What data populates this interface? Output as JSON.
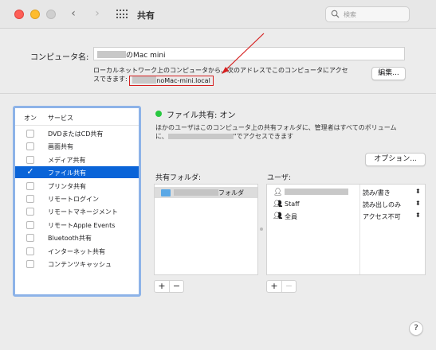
{
  "window": {
    "title": "共有",
    "search_placeholder": "検索",
    "back_icon": "chevron-left-icon",
    "forward_icon": "chevron-right-icon",
    "grid_icon": "grid-icon"
  },
  "computer_name": {
    "label": "コンピュータ名:",
    "value_suffix": "のMac mini",
    "local_text_line1": "ローカルネットワーク上のコンピュータから、次のアドレスでこのコンピュータにアクセ",
    "local_text_line2": "スできます:",
    "local_address_suffix": "noMac-mini.local",
    "edit_label": "編集..."
  },
  "services": {
    "col_on": "オン",
    "col_service": "サービス",
    "items": [
      {
        "label": "DVDまたはCD共有",
        "checked": false,
        "selected": false
      },
      {
        "label": "画面共有",
        "checked": false,
        "selected": false
      },
      {
        "label": "メディア共有",
        "checked": false,
        "selected": false
      },
      {
        "label": "ファイル共有",
        "checked": true,
        "selected": true
      },
      {
        "label": "プリンタ共有",
        "checked": false,
        "selected": false
      },
      {
        "label": "リモートログイン",
        "checked": false,
        "selected": false
      },
      {
        "label": "リモートマネージメント",
        "checked": false,
        "selected": false
      },
      {
        "label": "リモートApple Events",
        "checked": false,
        "selected": false
      },
      {
        "label": "Bluetooth共有",
        "checked": false,
        "selected": false
      },
      {
        "label": "インターネット共有",
        "checked": false,
        "selected": false
      },
      {
        "label": "コンテンツキャッシュ",
        "checked": false,
        "selected": false
      }
    ]
  },
  "file_sharing": {
    "status": "ファイル共有: オン",
    "status_color": "#28c840",
    "description_line1": "ほかのユーザはこのコンピュータ上の共有フォルダに、管理者はすべてのボリューム",
    "description_line2_prefix": "に、",
    "description_line2_suffix": "\"でアクセスできます",
    "options_label": "オプション...",
    "shared_folders_label": "共有フォルダ:",
    "users_label": "ユーザ:",
    "folders": [
      {
        "name_suffix": "フォルダ"
      }
    ],
    "users": [
      {
        "name": "",
        "icon": "user-icon",
        "permission": "読み/書き"
      },
      {
        "name": "Staff",
        "icon": "group-icon",
        "permission": "読み出しのみ"
      },
      {
        "name": "全員",
        "icon": "everyone-icon",
        "permission": "アクセス不可"
      }
    ],
    "add_label": "+",
    "remove_label": "−"
  },
  "help_label": "?",
  "colors": {
    "selection": "#0a64d8",
    "highlight_box": "#d61f1f",
    "focus_ring": "#8db3e8"
  }
}
